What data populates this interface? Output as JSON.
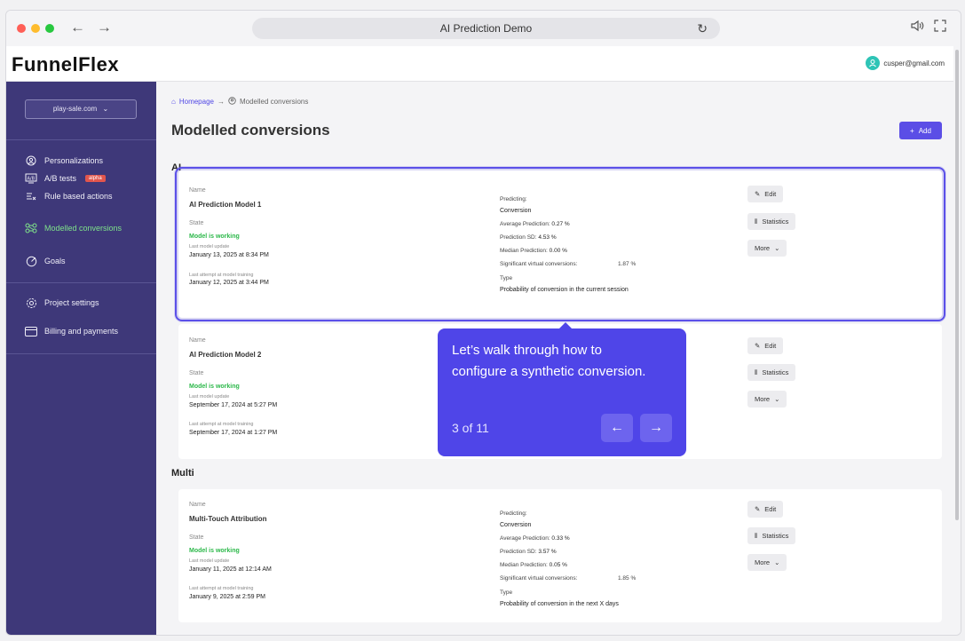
{
  "browser": {
    "url_title": "AI Prediction Demo"
  },
  "app": {
    "logo": "FunnelFlex",
    "user_email": "cusper@gmail.com"
  },
  "sidebar": {
    "project_select": "play-sale.com",
    "items": [
      {
        "label": "Personalizations"
      },
      {
        "label": "A/B tests",
        "badge": "alpha"
      },
      {
        "label": "Rule based actions"
      },
      {
        "label": "Modelled conversions"
      },
      {
        "label": "Goals"
      },
      {
        "label": "Project settings"
      },
      {
        "label": "Billing and payments"
      }
    ]
  },
  "main": {
    "breadcrumb_home": "Homepage",
    "breadcrumb_current": "Modelled conversions",
    "title": "Modelled conversions",
    "add_label": "Add",
    "sections": [
      {
        "title": "AI"
      },
      {
        "title": "Multi"
      }
    ],
    "labels": {
      "name": "Name",
      "state": "State",
      "last_update": "Last model update",
      "last_attempt": "Last attempt at model training",
      "predicting": "Predicting:",
      "avg": "Average Prediction:",
      "sd": "Prediction SD:",
      "median": "Median Prediction:",
      "significant": "Significant virtual conversions:",
      "type": "Type",
      "edit": "Edit",
      "statistics": "Statistics",
      "more": "More"
    },
    "cards": [
      {
        "name": "AI Prediction Model 1",
        "state": "Model is working",
        "last_update": "January 13, 2025 at 8:34 PM",
        "last_attempt": "January 12, 2025 at 3:44 PM",
        "predicting": "Conversion",
        "avg": "0.27 %",
        "sd": "4.53 %",
        "median": "0.00 %",
        "significant": "1.87 %",
        "type": "Probability of conversion in the current session"
      },
      {
        "name": "AI Prediction Model 2",
        "state": "Model is working",
        "last_update": "September 17, 2024 at 5:27 PM",
        "last_attempt": "September 17, 2024 at 1:27 PM"
      },
      {
        "name": "Multi-Touch Attribution",
        "state": "Model is working",
        "last_update": "January 11, 2025 at 12:14 AM",
        "last_attempt": "January 9, 2025 at 2:59 PM",
        "predicting": "Conversion",
        "avg": "0.33 %",
        "sd": "3.57 %",
        "median": "0.05 %",
        "significant": "1.85 %",
        "type": "Probability of conversion in the next X days"
      }
    ]
  },
  "tooltip": {
    "text": "Let’s walk through how to configure a synthetic conversion.",
    "step": "3 of 11"
  },
  "colors": {
    "sidebar": "#3e3879",
    "accent": "#5b4ee6",
    "success": "#2cb84a"
  }
}
